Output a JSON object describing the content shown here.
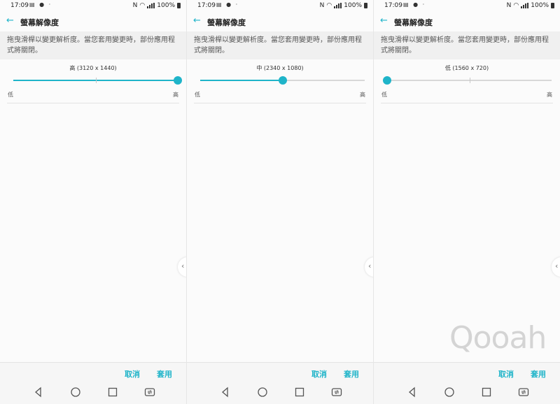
{
  "status_bar": {
    "time": "17:09",
    "battery": "100%"
  },
  "screen_title": "螢幕解像度",
  "description": "拖曳滑桿以變更解析度。當您套用變更時，部份應用程式將關閉。",
  "slider": {
    "min_label": "低",
    "max_label": "高"
  },
  "panels": [
    {
      "resolution_label": "高 (3120 x 1440)",
      "level": 1.0
    },
    {
      "resolution_label": "中 (2340 x 1080)",
      "level": 0.5
    },
    {
      "resolution_label": "低 (1560 x 720)",
      "level": 0.0
    }
  ],
  "buttons": {
    "cancel": "取消",
    "apply": "套用"
  },
  "watermark": "Qooah",
  "colors": {
    "accent": "#1fb4c9"
  }
}
